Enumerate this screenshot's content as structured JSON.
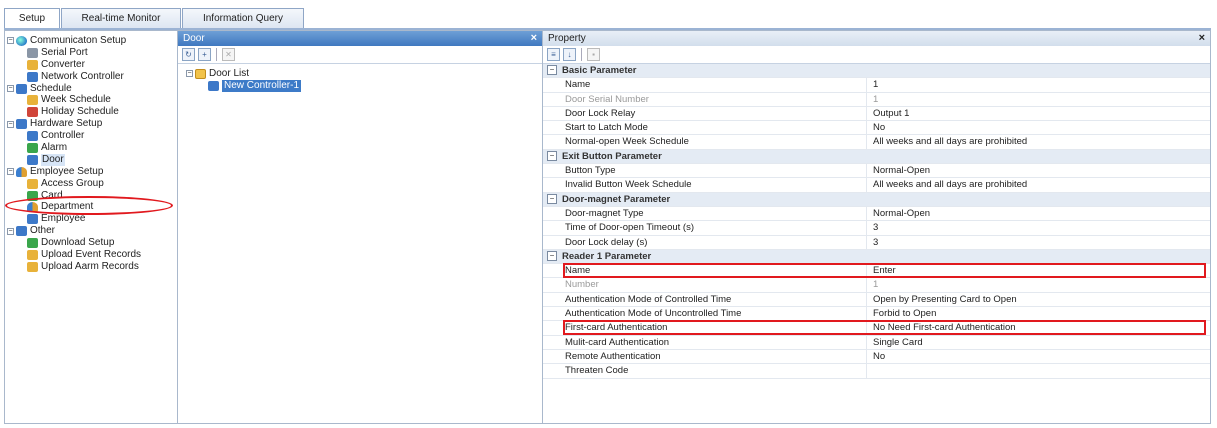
{
  "tabs": [
    "Setup",
    "Real-time Monitor",
    "Information Query"
  ],
  "left_tree": [
    {
      "label": "Communicaton Setup",
      "level": 0,
      "icon": "globe-icon",
      "expander": "−"
    },
    {
      "label": "Serial Port",
      "level": 1,
      "icon": "serial-port-icon"
    },
    {
      "label": "Converter",
      "level": 1,
      "icon": "converter-icon"
    },
    {
      "label": "Network Controller",
      "level": 1,
      "icon": "network-controller-icon"
    },
    {
      "label": "Schedule",
      "level": 0,
      "icon": "schedule-icon",
      "expander": "−"
    },
    {
      "label": "Week Schedule",
      "level": 1,
      "icon": "week-schedule-icon"
    },
    {
      "label": "Holiday Schedule",
      "level": 1,
      "icon": "holiday-schedule-icon"
    },
    {
      "label": "Hardware Setup",
      "level": 0,
      "icon": "hardware-icon",
      "expander": "−"
    },
    {
      "label": "Controller",
      "level": 1,
      "icon": "controller-icon"
    },
    {
      "label": "Alarm",
      "level": 1,
      "icon": "alarm-icon"
    },
    {
      "label": "Door",
      "level": 1,
      "icon": "door-icon"
    },
    {
      "label": "Employee Setup",
      "level": 0,
      "icon": "employee-icon",
      "expander": "−"
    },
    {
      "label": "Access Group",
      "level": 1,
      "icon": "access-group-icon"
    },
    {
      "label": "Card",
      "level": 1,
      "icon": "card-icon"
    },
    {
      "label": "Department",
      "level": 1,
      "icon": "department-icon"
    },
    {
      "label": "Employee",
      "level": 1,
      "icon": "person-icon"
    },
    {
      "label": "Other",
      "level": 0,
      "icon": "other-icon",
      "expander": "−"
    },
    {
      "label": "Download Setup",
      "level": 1,
      "icon": "download-icon"
    },
    {
      "label": "Upload Event Records",
      "level": 1,
      "icon": "upload-event-icon"
    },
    {
      "label": "Upload Aarm Records",
      "level": 1,
      "icon": "upload-alarm-icon"
    }
  ],
  "door_panel": {
    "title": "Door",
    "close": "×",
    "tree_root": "Door List",
    "tree_expander": "−",
    "tree_child": "New Controller-1"
  },
  "property_panel": {
    "title": "Property",
    "close": "×",
    "rows": [
      {
        "type": "cat",
        "label": "Basic Parameter"
      },
      {
        "label": "Name",
        "value": "1"
      },
      {
        "label": "Door Serial Number",
        "value": "1",
        "disabled": true
      },
      {
        "label": "Door Lock Relay",
        "value": "Output 1"
      },
      {
        "label": "Start to Latch Mode",
        "value": "No"
      },
      {
        "label": "Normal-open Week Schedule",
        "value": "All weeks and all days are prohibited"
      },
      {
        "type": "cat",
        "label": "Exit Button Parameter"
      },
      {
        "label": "Button Type",
        "value": "Normal-Open"
      },
      {
        "label": "Invalid Button Week Schedule",
        "value": "All weeks and all days are prohibited"
      },
      {
        "type": "cat",
        "label": "Door-magnet Parameter"
      },
      {
        "label": "Door-magnet Type",
        "value": "Normal-Open"
      },
      {
        "label": "Time of Door-open Timeout (s)",
        "value": "3"
      },
      {
        "label": "Door Lock delay (s)",
        "value": "3"
      },
      {
        "type": "cat",
        "label": "Reader 1 Parameter"
      },
      {
        "label": "Name",
        "value": "Enter"
      },
      {
        "label": "Number",
        "value": "1",
        "disabled": true
      },
      {
        "label": "Authentication Mode of Controlled Time",
        "value": "Open by Presenting Card to Open"
      },
      {
        "label": "Authentication Mode of Uncontrolled Time",
        "value": "Forbid to Open"
      },
      {
        "label": "First-card Authentication",
        "value": "No Need First-card Authentication"
      },
      {
        "label": "Mulit-card Authentication",
        "value": "Single Card"
      },
      {
        "label": "Remote Authentication",
        "value": "No"
      },
      {
        "label": "Threaten Code",
        "value": ""
      }
    ]
  },
  "colors": {
    "highlight": "#e1191e",
    "selection": "#3d7bc8",
    "category_bg": "#e4ebf4"
  }
}
